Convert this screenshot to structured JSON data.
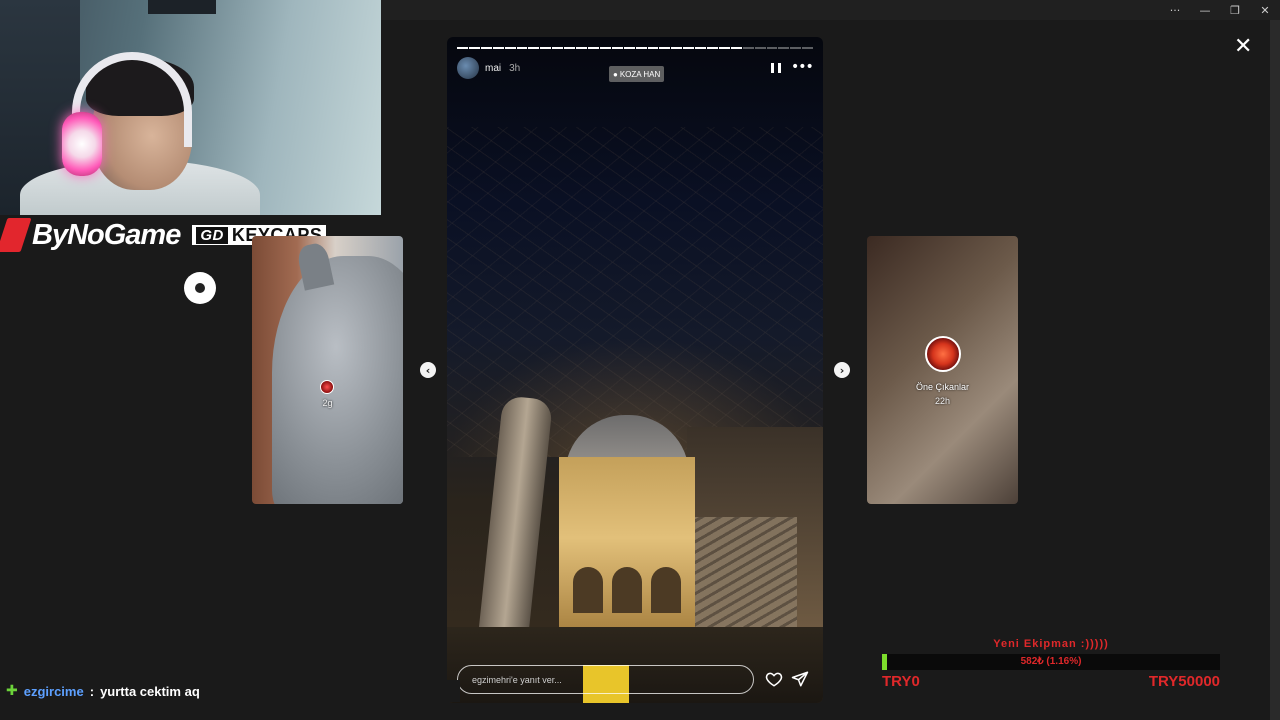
{
  "window": {
    "controls": [
      "···",
      "—",
      "❐",
      "✕"
    ]
  },
  "sponsor": {
    "brand": "ByNoGame",
    "keycaps_logo": "GD",
    "keycaps": "KEYCAPS"
  },
  "story": {
    "username": "mai",
    "time": "3h",
    "location": "KOZA HAN",
    "reply_placeholder": "egzimehri'e yanıt ver...",
    "progress_segments": 30,
    "progress_done": 24
  },
  "prev_card": {
    "time": "2g"
  },
  "next_card": {
    "name": "Öne Çıkanlar",
    "time": "22h"
  },
  "icons": {
    "close": "close-icon",
    "prev": "chevron-left-icon",
    "next": "chevron-right-icon",
    "pause": "pause-icon",
    "more": "more-icon",
    "heart": "heart-icon",
    "send": "send-icon"
  },
  "chat": {
    "user": "ezgircime",
    "separator": ":",
    "message": "yurtta cektim aq"
  },
  "goal": {
    "title": "Yeni Ekipman :)))))",
    "progress_text": "582₺ (1.16%)",
    "progress_fraction": 0.0116,
    "min": "TRY0",
    "max": "TRY50000",
    "color": "#e0282a",
    "fill_color": "#7dde2c"
  }
}
